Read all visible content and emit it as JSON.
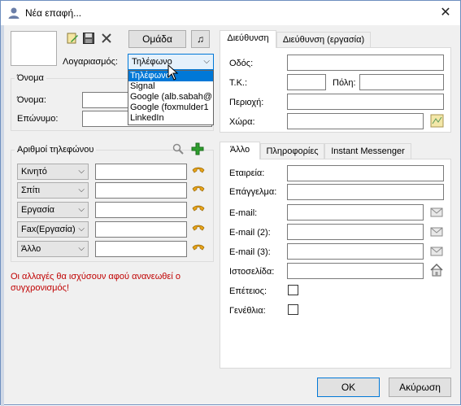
{
  "window": {
    "title": "Νέα επαφή...",
    "close_glyph": "✕"
  },
  "header": {
    "group_button": "Ομάδα",
    "music_glyph": "♫",
    "account_label": "Λογαριασμός:",
    "account_value": "Τηλέφωνο",
    "account_options": [
      "Τηλέφωνο",
      "Signal",
      "Google (alb.sabah@",
      "Google (foxmulder1",
      "LinkedIn"
    ]
  },
  "name_group": {
    "title": "Όνομα",
    "first_label": "Όνομα:",
    "last_label": "Επώνυμο:"
  },
  "phones": {
    "title": "Αριθμοί τηλεφώνου",
    "rows": [
      {
        "type": "Κινητό"
      },
      {
        "type": "Σπίτι"
      },
      {
        "type": "Εργασία"
      },
      {
        "type": "Fax(Εργασία)"
      },
      {
        "type": "Άλλο"
      }
    ]
  },
  "warning": "Οι αλλαγές θα ισχύσουν αφού ανανεωθεί ο συγχρονισμός!",
  "address_tabs": {
    "tabs": [
      "Διεύθυνση",
      "Διεύθυνση (εργασία)"
    ],
    "street_label": "Οδός:",
    "zip_label": "Τ.Κ.:",
    "city_label": "Πόλη:",
    "region_label": "Περιοχή:",
    "country_label": "Χώρα:"
  },
  "other_tabs": {
    "tabs": [
      "Άλλο",
      "Πληροφορίες",
      "Instant Messenger"
    ],
    "company_label": "Εταιρεία:",
    "job_label": "Επάγγελμα:",
    "email1_label": "E-mail:",
    "email2_label": "E-mail (2):",
    "email3_label": "E-mail (3):",
    "website_label": "Ιστοσελίδα:",
    "anniversary_label": "Επέτειος:",
    "birthday_label": "Γενέθλια:"
  },
  "footer": {
    "ok": "OK",
    "cancel": "Ακύρωση"
  },
  "colors": {
    "warning": "#c00000",
    "selection": "#0078d7",
    "phone_icon": "#e8a317"
  }
}
